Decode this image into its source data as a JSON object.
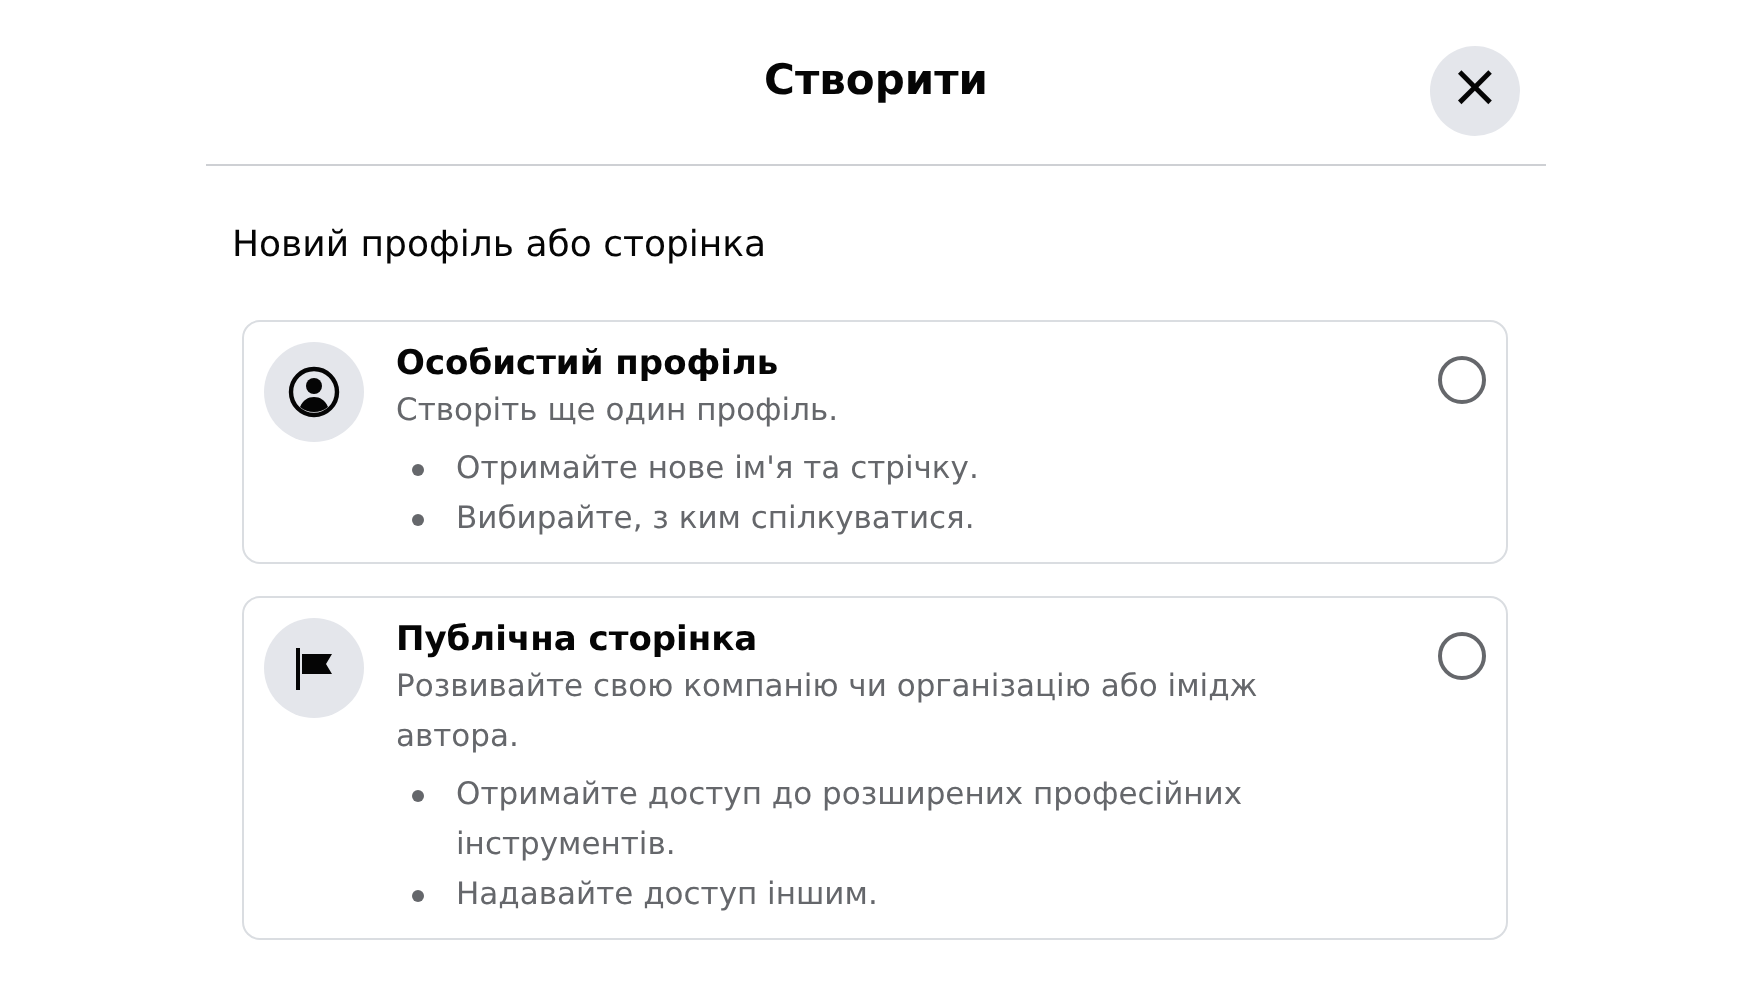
{
  "dialog": {
    "title": "Створити",
    "close": "×"
  },
  "section": {
    "heading": "Новий профіль або сторінка"
  },
  "options": [
    {
      "kind": "profile",
      "title": "Особистий профіль",
      "description": "Створіть ще один профіль.",
      "selected": false,
      "points": [
        "Отримайте нове ім'я та стрічку.",
        "Вибирайте, з ким спілкуватися."
      ]
    },
    {
      "kind": "page",
      "title": "Публічна сторінка",
      "description": "Розвивайте свою компанію чи організацію або імідж автора.",
      "selected": false,
      "points": [
        "Отримайте доступ до розширених професійних інструментів.",
        "Надавайте доступ іншим."
      ]
    }
  ]
}
